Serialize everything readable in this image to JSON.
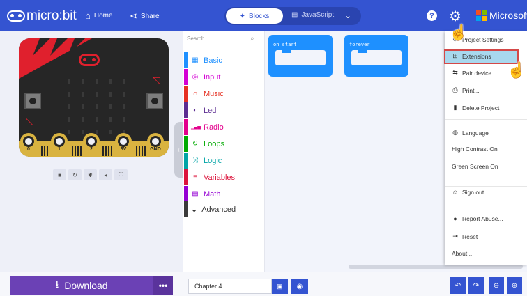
{
  "header": {
    "brand": "micro:bit",
    "home": "Home",
    "share": "Share",
    "blocks": "Blocks",
    "javascript": "JavaScript",
    "help": "?",
    "microsoft": "Microsoft",
    "ms_colors": [
      "#f25022",
      "#7fba00",
      "#00a4ef",
      "#ffb900"
    ]
  },
  "simulator": {
    "pins": [
      "0",
      "1",
      "2",
      "3V",
      "GND"
    ]
  },
  "toolbox": {
    "search_placeholder": "Search...",
    "categories": [
      {
        "label": "Basic",
        "color": "#1e90ff",
        "icon": "grid-icon"
      },
      {
        "label": "Input",
        "color": "#d400d4",
        "icon": "target-icon"
      },
      {
        "label": "Music",
        "color": "#e63022",
        "icon": "headphones-icon"
      },
      {
        "label": "Led",
        "color": "#5c2d91",
        "icon": "toggle-icon"
      },
      {
        "label": "Radio",
        "color": "#e3008c",
        "icon": "signal-icon"
      },
      {
        "label": "Loops",
        "color": "#00aa00",
        "icon": "loop-icon"
      },
      {
        "label": "Logic",
        "color": "#00a4a6",
        "icon": "shuffle-icon"
      },
      {
        "label": "Variables",
        "color": "#dc143c",
        "icon": "lines-icon"
      },
      {
        "label": "Math",
        "color": "#9400d3",
        "icon": "calculator-icon"
      }
    ],
    "advanced": "Advanced"
  },
  "workspace": {
    "blocks": [
      {
        "label": "on start"
      },
      {
        "label": "forever"
      }
    ]
  },
  "menu": {
    "items": [
      {
        "label": "Project Settings",
        "icon": "gear-icon"
      },
      {
        "label": "Extensions",
        "icon": "plus-square-icon",
        "highlighted": true
      },
      {
        "label": "Pair device",
        "icon": "usb-icon"
      },
      {
        "label": "Print...",
        "icon": "printer-icon"
      },
      {
        "label": "Delete Project",
        "icon": "trash-icon"
      },
      {
        "label": "Language",
        "icon": "globe-icon"
      },
      {
        "label": "High Contrast On",
        "icon": ""
      },
      {
        "label": "Green Screen On",
        "icon": ""
      },
      {
        "label": "Sign out",
        "icon": "user-icon"
      },
      {
        "label": "Report Abuse...",
        "icon": "flag-icon"
      },
      {
        "label": "Reset",
        "icon": "sign-out-icon"
      },
      {
        "label": "About...",
        "icon": ""
      }
    ]
  },
  "footer": {
    "download": "Download",
    "more": "•••",
    "project_name": "Chapter 4"
  }
}
